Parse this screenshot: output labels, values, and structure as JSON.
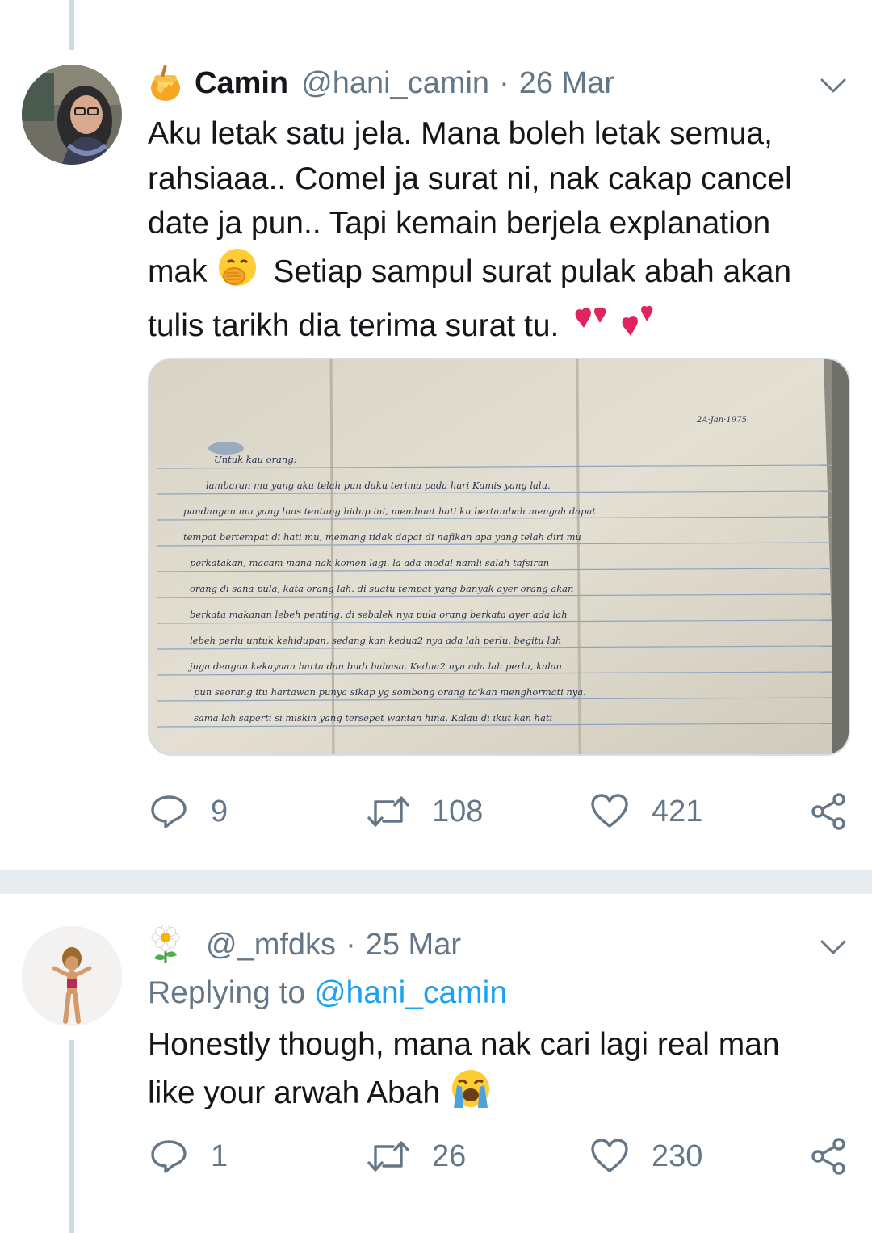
{
  "tweets": [
    {
      "display_name": "Camin",
      "handle": "@hani_camin",
      "separator": "·",
      "date": "26 Mar",
      "text_lines": [
        "Aku letak satu jela. Mana boleh letak semua,",
        "rahsiaaa.. Comel ja surat ni, nak cakap cancel",
        "date ja pun.. Tapi kemain berjela explanation"
      ],
      "text_line4a": "mak",
      "text_line4b": "Setiap sampul surat pulak abah akan",
      "text_line5": "tulis tarikh dia terima surat tu.",
      "media_alt": "Handwritten letter photo",
      "letter": {
        "date": "2A·Jan·1975.",
        "lines": [
          "Untuk kau orang:",
          "lambaran mu yang aku telah pun daku terima pada hari Kamis yang lalu.",
          "pandangan mu yang luas tentang hidup ini, membuat hati ku bertambah mengah dapat",
          "tempat bertempat di hati mu, memang tidak dapat di nafikan apa yang telah diri mu",
          "perkatakan, macam mana nak komen lagi. la ada modal namli salah tafsiran",
          "orang di sana pula, kata orang lah. di suatu tempat yang banyak ayer orang akan",
          "berkata makanan lebeh penting. di sebalek nya pula orang berkata ayer ada lah",
          "lebeh perlu untuk kehidupan, sedang kan kedua2 nya ada lah perlu. begitu lah",
          "juga dengan kekayaan harta dan budi bahasa. Kedua2 nya ada lah perlu, kalau",
          "pun seorang itu hartawan punya sikap yg sombong orang ta'kan menghormati nya.",
          "sama lah saperti si miskin yang tersepet wantan hina. Kalau di ikut kan hati"
        ]
      },
      "stats": {
        "replies": "9",
        "retweets": "108",
        "likes": "421"
      }
    },
    {
      "display_name": "",
      "handle": "@_mfdks",
      "separator": "·",
      "date": "25 Mar",
      "replying_prefix": "Replying to",
      "replying_to": "@hani_camin",
      "text_line1": "Honestly though, mana nak cari lagi real man",
      "text_line2": "like your arwah Abah",
      "stats": {
        "replies": "1",
        "retweets": "26",
        "likes": "230"
      }
    }
  ],
  "colors": {
    "text": "#14171a",
    "muted": "#657786",
    "link": "#1da1f2",
    "divider": "#e6ecf0",
    "thread_line": "#cfd9de"
  }
}
